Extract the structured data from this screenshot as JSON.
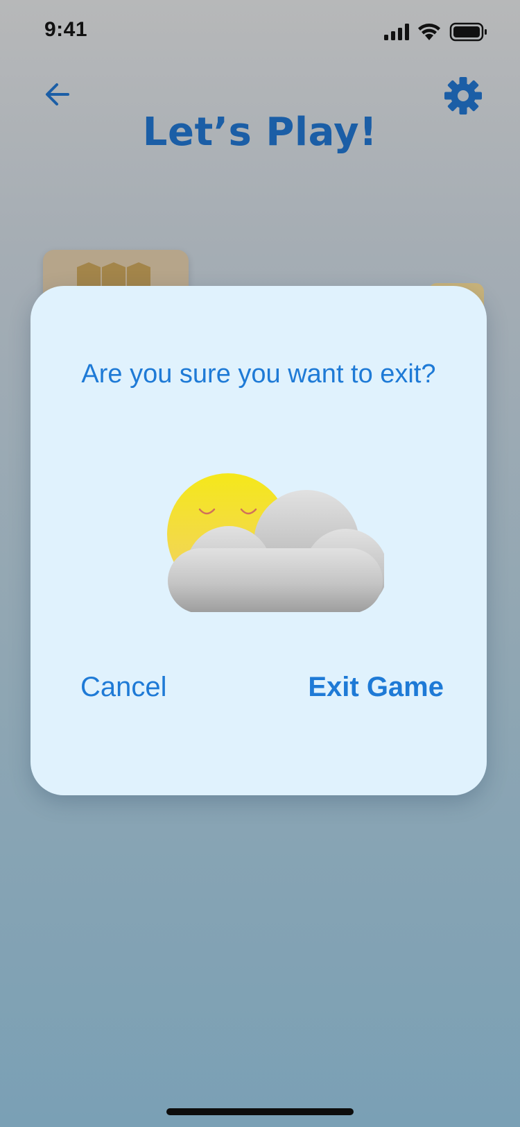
{
  "status_bar": {
    "time": "9:41",
    "icons": [
      "signal-icon",
      "wifi-icon",
      "battery-icon"
    ]
  },
  "header": {
    "back_icon": "arrow-left-icon",
    "title": "Let’s Play!",
    "settings_icon": "gear-icon"
  },
  "dialog": {
    "message": "Are you sure you want to exit?",
    "illustration": "sleepy-sun-behind-cloud",
    "cancel_label": "Cancel",
    "exit_label": "Exit Game"
  },
  "colors": {
    "accent": "#1e7ad6",
    "title": "#1b5ea6",
    "dialog_bg": "#e0f2fd"
  }
}
